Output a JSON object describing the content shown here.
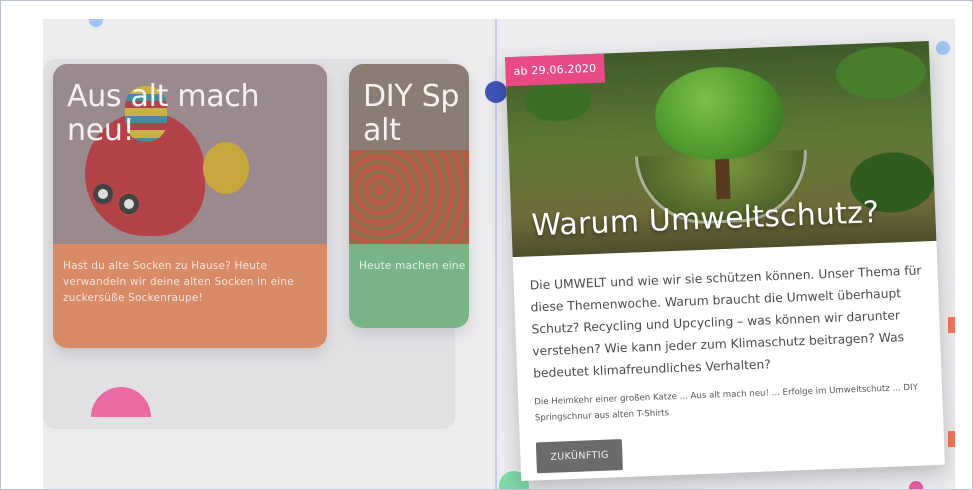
{
  "carousel": {
    "cards": [
      {
        "title": "Aus alt mach neu!",
        "text": "Hast du alte Socken zu Hause? Heute verwandeln wir deine alten Socken in eine zuckersüße Sockenraupe!",
        "color": "#d98a66"
      },
      {
        "title": "DIY Sp aus alt",
        "text": "Heute machen eine bunte Spr",
        "color": "#79b488"
      }
    ]
  },
  "feature": {
    "date_badge": "ab 29.06.2020",
    "title": "Warum Umweltschutz?",
    "description": "Die UMWELT und wie wir sie schützen können. Unser Thema für diese Themenwoche. Warum braucht die Umwelt überhaupt Schutz? Recycling und Upcycling – was können wir darunter verstehen? Wie kann jeder zum Klimaschutz beitragen? Was bedeutet klimafreundliches Verhalten?",
    "links": "Die Heimkehr einer großen Katze ... Aus alt mach neu! ... Erfolge im Umweltschutz ... DIY Springschnur aus alten T-Shirts",
    "button_label": "ZUKÜNFTIG",
    "badge_color": "#e84a88"
  }
}
